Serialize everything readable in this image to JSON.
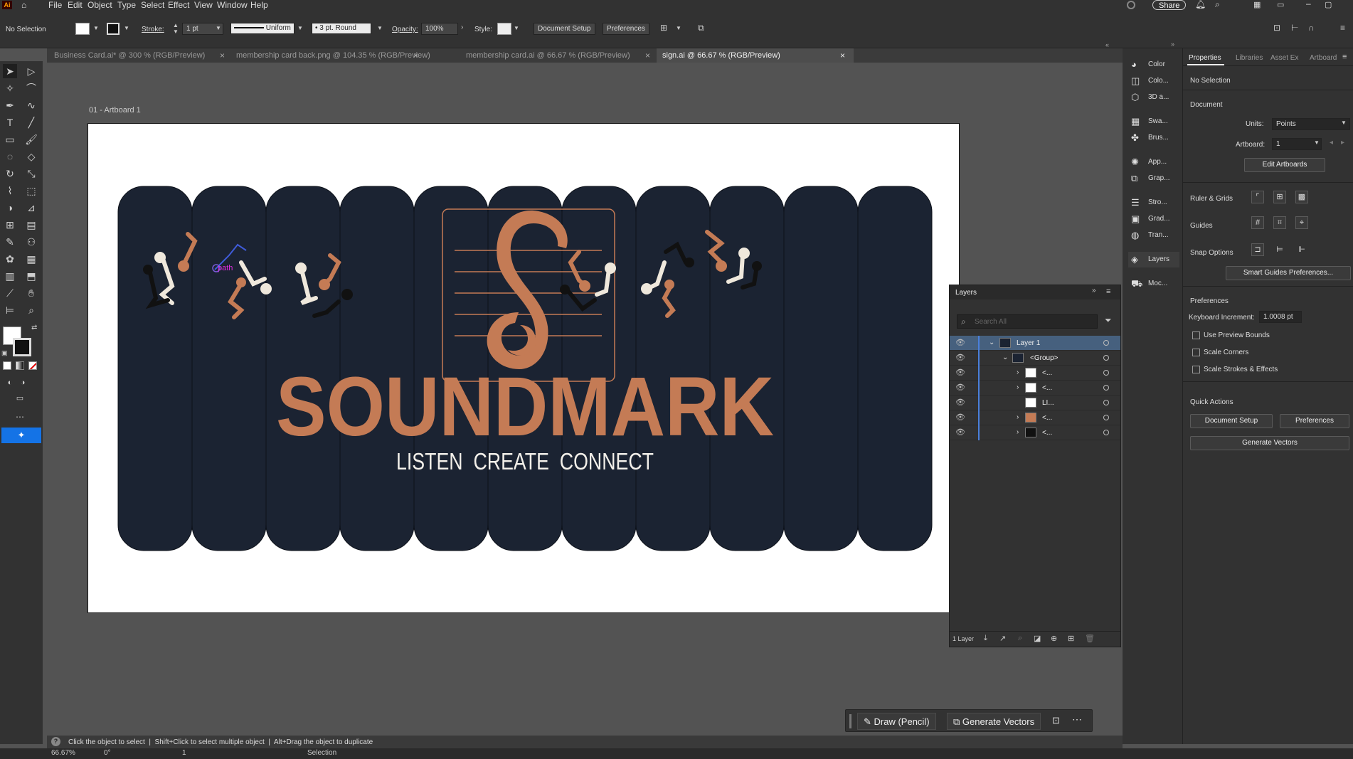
{
  "app": {
    "logo": "Ai"
  },
  "menu": [
    "File",
    "Edit",
    "Object",
    "Type",
    "Select",
    "Effect",
    "View",
    "Window",
    "Help"
  ],
  "topright": {
    "share": "Share"
  },
  "control": {
    "selection": "No Selection",
    "stroke_label": "Stroke:",
    "stroke_value": "1 pt",
    "profile": "Uniform",
    "brush": "3 pt. Round",
    "opacity_label": "Opacity:",
    "opacity_value": "100%",
    "style_label": "Style:",
    "doc_setup": "Document Setup",
    "preferences": "Preferences"
  },
  "tabs": [
    {
      "label": "Business Card.ai* @ 300 % (RGB/Preview)",
      "active": false
    },
    {
      "label": "membership card back.png @ 104.35 % (RGB/Preview)",
      "active": false
    },
    {
      "label": "membership card.ai @ 66.67 % (RGB/Preview)",
      "active": false
    },
    {
      "label": "sign.ai @ 66.67 % (RGB/Preview)",
      "active": true
    }
  ],
  "artboard": {
    "name": "01 - Artboard 1",
    "logo_title": "SOUNDMARK",
    "tagline": "LISTEN  CREATE  CONNECT",
    "hover_label": "path",
    "colors": {
      "navy": "#1b2332",
      "copper": "#c47b55",
      "cream": "#efe8dc",
      "black": "#111111"
    }
  },
  "right_strip": [
    {
      "label": "Color",
      "icon": "color-icon"
    },
    {
      "label": "Colo...",
      "icon": "color-guide-icon"
    },
    {
      "label": "3D a...",
      "icon": "3d-icon"
    },
    {
      "label": "Swa...",
      "icon": "swatches-icon"
    },
    {
      "label": "Brus...",
      "icon": "brushes-icon"
    },
    {
      "label": "App...",
      "icon": "appearance-icon"
    },
    {
      "label": "Grap...",
      "icon": "graphic-styles-icon"
    },
    {
      "label": "Stro...",
      "icon": "stroke-icon"
    },
    {
      "label": "Grad...",
      "icon": "gradient-icon"
    },
    {
      "label": "Tran...",
      "icon": "transparency-icon"
    },
    {
      "label": "Layers",
      "icon": "layers-icon"
    },
    {
      "label": "Moc...",
      "icon": "mockup-icon"
    }
  ],
  "properties": {
    "tabs": [
      "Properties",
      "Libraries",
      "Asset Ex",
      "Artboard"
    ],
    "no_selection": "No Selection",
    "document": "Document",
    "units_label": "Units:",
    "units_value": "Points",
    "artboard_label": "Artboard:",
    "artboard_value": "1",
    "edit_artboards": "Edit Artboards",
    "ruler_grids": "Ruler & Grids",
    "guides": "Guides",
    "snap_options": "Snap Options",
    "smart_guides": "Smart Guides Preferences...",
    "preferences": "Preferences",
    "keyboard_increment_label": "Keyboard Increment:",
    "keyboard_increment_value": "1.0008 pt",
    "use_preview_bounds": "Use Preview Bounds",
    "scale_corners": "Scale Corners",
    "scale_strokes": "Scale Strokes & Effects",
    "quick_actions": "Quick Actions",
    "doc_setup": "Document Setup",
    "preferences_btn": "Preferences",
    "generate_vectors": "Generate Vectors"
  },
  "layers_panel": {
    "title": "Layers",
    "search_placeholder": "Search All",
    "rows": [
      {
        "name": "Layer 1",
        "indent": 0,
        "expanded": true,
        "selected": true
      },
      {
        "name": "<Group>",
        "indent": 1,
        "expanded": true,
        "selected": false
      },
      {
        "name": "<...",
        "indent": 2,
        "expanded": false,
        "selected": false
      },
      {
        "name": "<...",
        "indent": 2,
        "expanded": false,
        "selected": false
      },
      {
        "name": "LI...",
        "indent": 2,
        "expanded": null,
        "selected": false
      },
      {
        "name": "<...",
        "indent": 2,
        "expanded": false,
        "selected": false
      },
      {
        "name": "<...",
        "indent": 2,
        "expanded": false,
        "selected": false
      }
    ],
    "footer": "1 Layer"
  },
  "context_bar": {
    "draw": "Draw (Pencil)",
    "generate": "Generate Vectors"
  },
  "status": {
    "hint": "Click the object to select  |  Shift+Click to select multiple object  |  Alt+Drag the object to duplicate"
  },
  "bottom": {
    "zoom": "66.67%",
    "rotation": "0°",
    "artboard": "1",
    "tool": "Selection"
  }
}
